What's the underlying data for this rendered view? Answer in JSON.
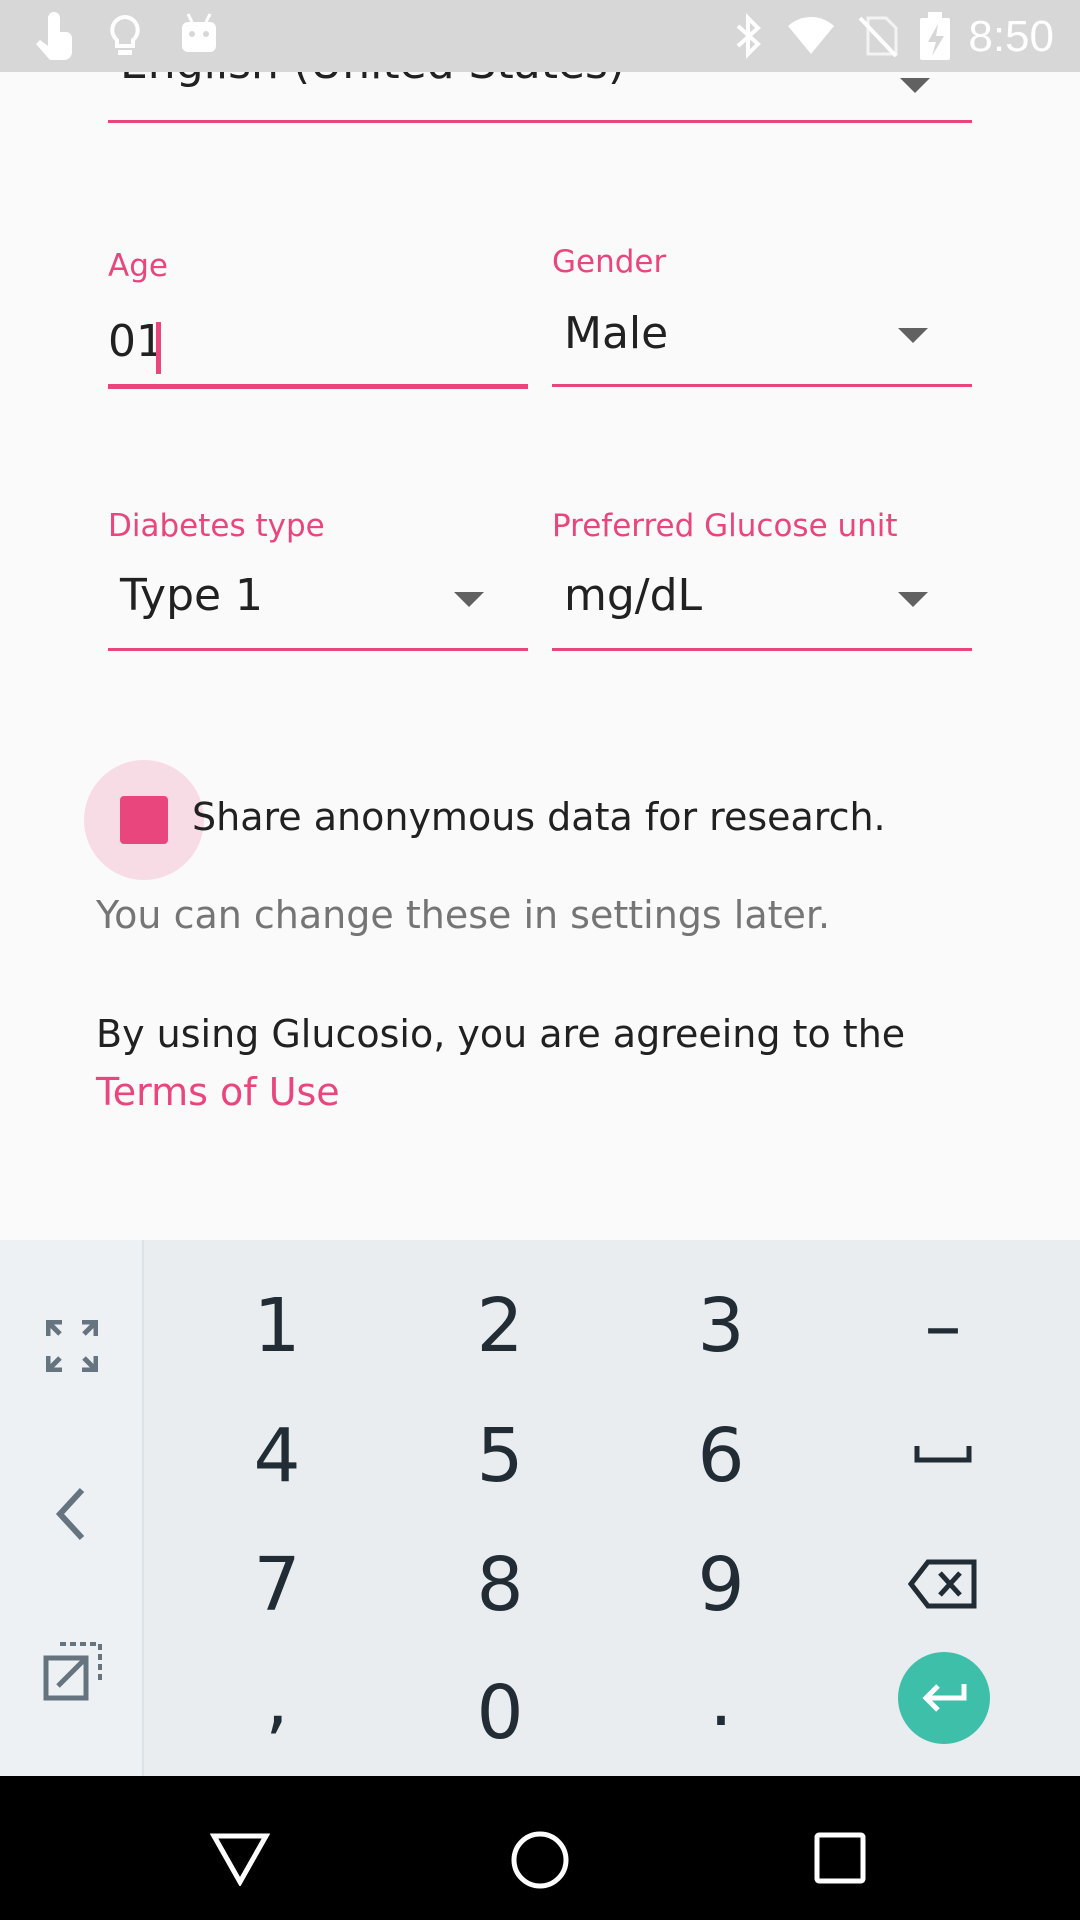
{
  "status_bar": {
    "time": "8:50",
    "left_icons": [
      "touch-icon",
      "lightbulb-icon",
      "android-icon"
    ],
    "right_icons": [
      "bluetooth-icon",
      "wifi-icon",
      "no-sim-icon",
      "battery-icon"
    ]
  },
  "form": {
    "language_value": "English (United States)",
    "age": {
      "label": "Age",
      "value": "01"
    },
    "gender": {
      "label": "Gender",
      "value": "Male"
    },
    "diabetes_type": {
      "label": "Diabetes type",
      "value": "Type 1"
    },
    "glucose_unit": {
      "label": "Preferred Glucose unit",
      "value": "mg/dL"
    },
    "share_checkbox": {
      "label": "Share anonymous data for research.",
      "checked": true
    },
    "hint": "You can change these in settings later.",
    "agreement_text": "By using Glucosio, you are agreeing to the",
    "terms_link": "Terms of Use"
  },
  "keyboard": {
    "rows": [
      [
        "1",
        "2",
        "3",
        "–"
      ],
      [
        "4",
        "5",
        "6",
        "space"
      ],
      [
        "7",
        "8",
        "9",
        "backspace"
      ],
      [
        ",",
        "0",
        ".",
        "enter"
      ]
    ],
    "side_icons": [
      "fullscreen-icon",
      "back-chevron-icon",
      "popout-icon"
    ]
  },
  "colors": {
    "accent": "#E8467C",
    "enter_key": "#3EBFA9",
    "status_bar": "#D7D7D7",
    "nav_bar": "#000000"
  },
  "navbar": {
    "icons": [
      "back-triangle-icon",
      "home-circle-icon",
      "recents-square-icon"
    ]
  }
}
